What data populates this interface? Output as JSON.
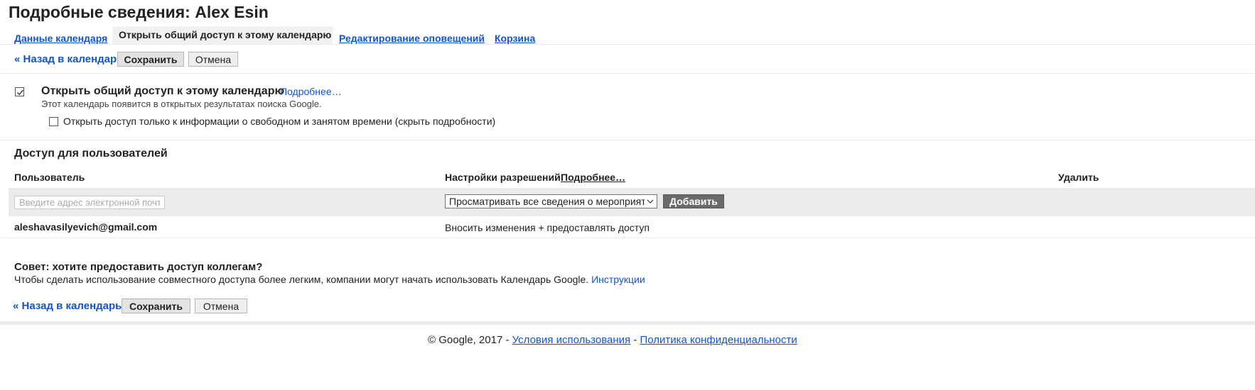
{
  "page": {
    "title": "Подробные сведения: Alex Esin"
  },
  "tabs": [
    {
      "label": "Данные календаря",
      "active": false
    },
    {
      "label": "Открыть общий доступ к этому календарю",
      "active": true
    },
    {
      "label": "Редактирование оповещений",
      "active": false
    },
    {
      "label": "Корзина",
      "active": false
    }
  ],
  "toolbar": {
    "back_label": "« Назад в календарь",
    "save_label": "Сохранить",
    "cancel_label": "Отмена"
  },
  "public_share": {
    "checked": true,
    "label": "Открыть общий доступ к этому календарю",
    "more_link": "Подробнее…",
    "description": "Этот календарь появится в открытых результатах поиска Google.",
    "freebusy_checked": false,
    "freebusy_label": "Открыть доступ только к информации о свободном и занятом времени (скрыть подробности)"
  },
  "user_access": {
    "title": "Доступ для пользователей",
    "col_user": "Пользователь",
    "col_permissions": "Настройки разрешений",
    "col_permissions_link": "Подробнее…",
    "col_delete": "Удалить",
    "email_placeholder": "Введите адрес электронной почты",
    "permission_selected": "Просматривать все сведения о мероприятиях",
    "add_label": "Добавить",
    "rows": [
      {
        "user": "aleshavasilyevich@gmail.com",
        "permission": "Вносить изменения + предоставлять доступ"
      }
    ]
  },
  "tip": {
    "title": "Совет: хотите предоставить доступ коллегам?",
    "text": "Чтобы сделать использование совместного доступа более легким, компании могут начать использовать Календарь Google.",
    "link": "Инструкции"
  },
  "footer": {
    "copyright": "© Google, 2017 -",
    "terms": "Условия использования",
    "separator": "-",
    "privacy": "Политика конфиденциальности"
  },
  "colors": {
    "link": "#1155cc",
    "add_button": "#6a6a6a",
    "row_bg": "#ebebeb"
  }
}
